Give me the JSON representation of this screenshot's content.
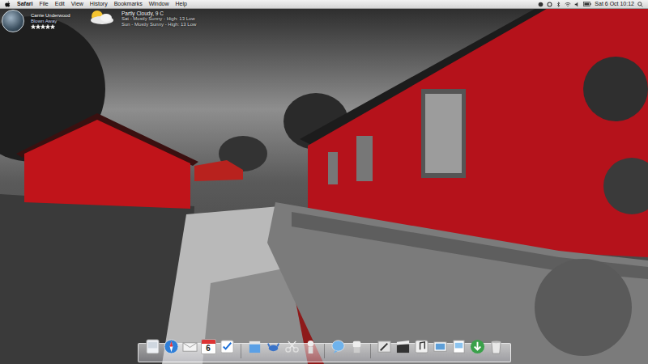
{
  "menubar": {
    "app": "Safari",
    "menus": [
      "File",
      "Edit",
      "View",
      "History",
      "Bookmarks",
      "Window",
      "Help"
    ],
    "clock": "Sat 6 Oct  10:12"
  },
  "itunes": {
    "artist": "Carrie Underwood",
    "title": "Blown Away",
    "stars": 5
  },
  "weather": {
    "current": "Partly Cloudy, 9 C",
    "forecast": [
      "Sat - Mostly Sunny - High: 13 Low",
      "Sun - Mostly Sunny - High: 13 Low"
    ]
  },
  "dock": {
    "calendar_day": "6"
  }
}
